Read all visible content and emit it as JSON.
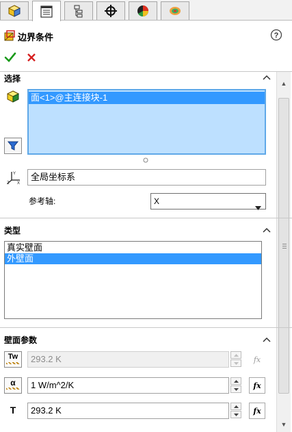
{
  "tabs": [
    {
      "icon": "part-manager-icon",
      "active": false
    },
    {
      "icon": "property-manager-icon",
      "active": true
    },
    {
      "icon": "configuration-manager-icon",
      "active": false
    },
    {
      "icon": "dimxpert-manager-icon",
      "active": false
    },
    {
      "icon": "display-manager-icon",
      "active": false
    },
    {
      "icon": "flow-simulation-icon",
      "active": false
    }
  ],
  "header": {
    "title": "边界条件",
    "help_symbol": "?",
    "ok_symbol": "✓",
    "cancel_symbol": "✕"
  },
  "selection": {
    "title": "选择",
    "items": [
      "面<1>@主连接块-1"
    ],
    "coordinate_system": "全局坐标系",
    "reference_axis_label": "参考轴:",
    "reference_axis_value": "X"
  },
  "type": {
    "title": "类型",
    "options": [
      "真实壁面",
      "外壁面"
    ],
    "selected_index": 1
  },
  "wall_params": {
    "title": "壁面参数",
    "rows": [
      {
        "icon": "wall-temperature-icon",
        "icon_text": "Tw",
        "value": "293.2 K",
        "enabled": false
      },
      {
        "icon": "heat-transfer-coefficient-icon",
        "icon_text": "α",
        "value": "1 W/m^2/K",
        "enabled": true
      },
      {
        "icon": "temperature-icon",
        "icon_text": "T",
        "value": "293.2 K",
        "enabled": true
      }
    ],
    "fx_label": "fx"
  },
  "colors": {
    "selection_bg": "#bde0ff",
    "selection_border": "#5fa8e8",
    "list_selected": "#3399ff",
    "ok_green": "#1a9a1a",
    "cancel_red": "#d62020"
  }
}
